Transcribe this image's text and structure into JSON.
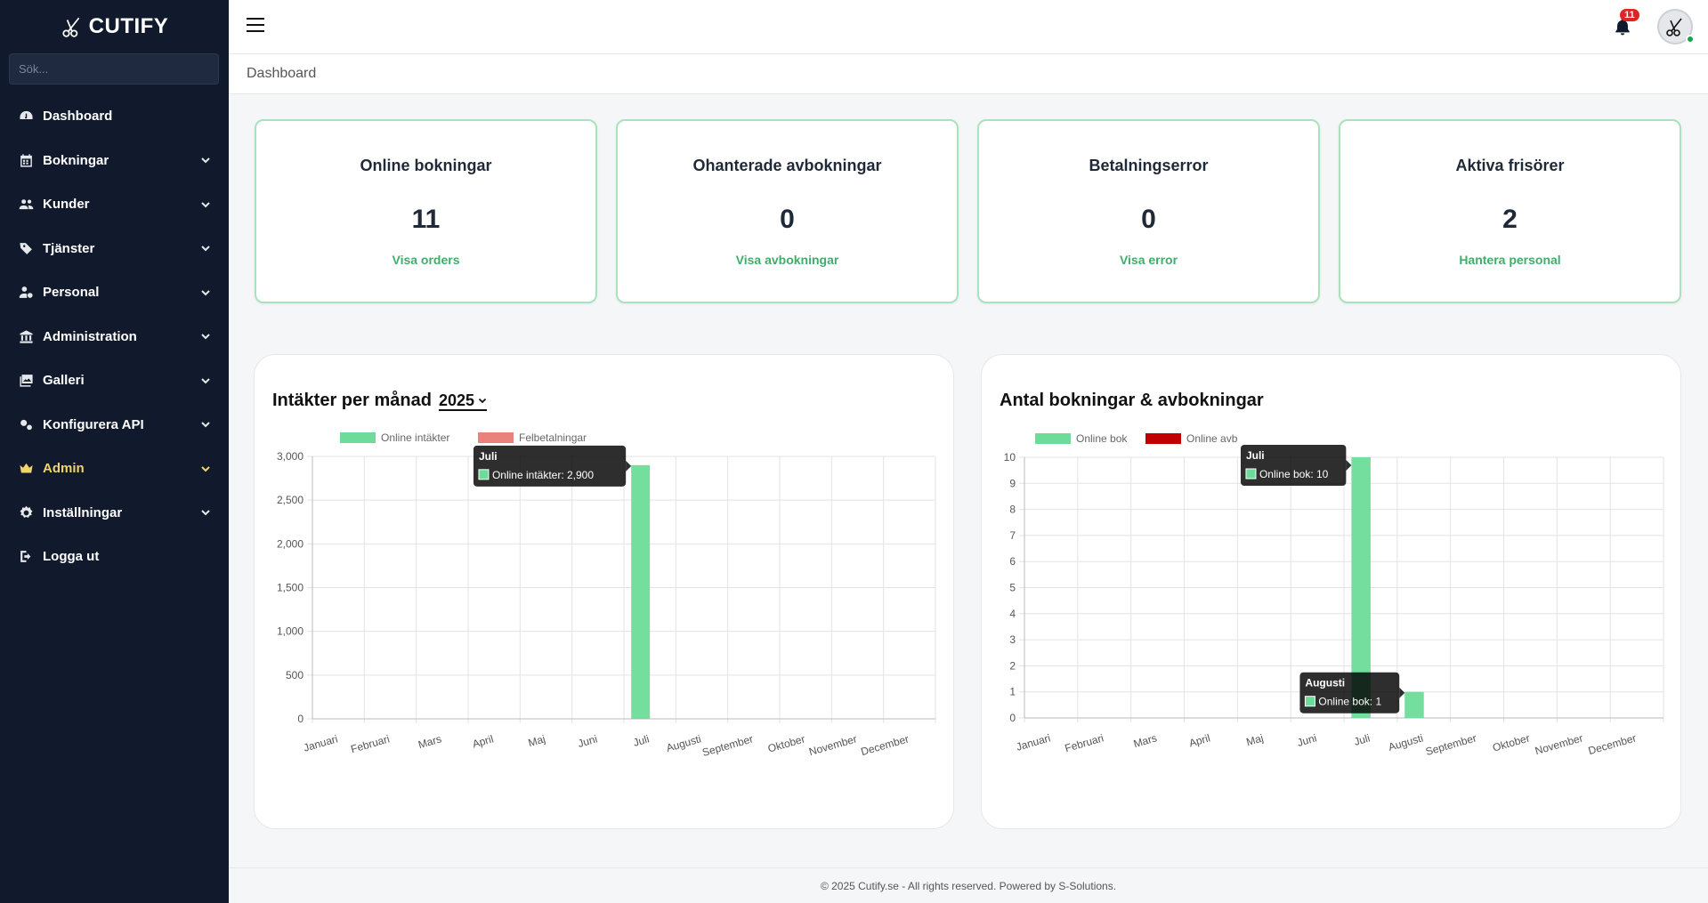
{
  "app": {
    "name": "CUTIFY"
  },
  "sidebar": {
    "search_placeholder": "Sök...",
    "items": [
      {
        "label": "Dashboard",
        "icon": "gauge-icon",
        "chevron": false
      },
      {
        "label": "Bokningar",
        "icon": "calendar-icon",
        "chevron": true
      },
      {
        "label": "Kunder",
        "icon": "users-icon",
        "chevron": true
      },
      {
        "label": "Tjänster",
        "icon": "tags-icon",
        "chevron": true
      },
      {
        "label": "Personal",
        "icon": "user-gear-icon",
        "chevron": true
      },
      {
        "label": "Administration",
        "icon": "bank-icon",
        "chevron": true
      },
      {
        "label": "Galleri",
        "icon": "images-icon",
        "chevron": true
      },
      {
        "label": "Konfigurera API",
        "icon": "gears-icon",
        "chevron": true
      },
      {
        "label": "Admin",
        "icon": "crown-icon",
        "chevron": true
      },
      {
        "label": "Inställningar",
        "icon": "gear-icon",
        "chevron": true
      },
      {
        "label": "Logga ut",
        "icon": "logout-icon",
        "chevron": false
      }
    ]
  },
  "topbar": {
    "notification_count": "11"
  },
  "breadcrumb": "Dashboard",
  "cards": [
    {
      "title": "Online bokningar",
      "value": "11",
      "link": "Visa orders"
    },
    {
      "title": "Ohanterade avbokningar",
      "value": "0",
      "link": "Visa avbokningar"
    },
    {
      "title": "Betalningserror",
      "value": "0",
      "link": "Visa error"
    },
    {
      "title": "Aktiva frisörer",
      "value": "2",
      "link": "Hantera personal"
    }
  ],
  "colors": {
    "accent": "#3fae6a",
    "sidebar": "#111a2d",
    "series_green": "#6ddc9a",
    "series_red": "#e9827a",
    "series_darkred": "#c00000"
  },
  "charts": {
    "revenue": {
      "title": "Intäkter per månad",
      "year": "2025"
    },
    "bookings": {
      "title": "Antal bokningar & avbokningar"
    }
  },
  "chart_data": [
    {
      "type": "bar",
      "title": "Intäkter per månad",
      "categories": [
        "Januari",
        "Februari",
        "Mars",
        "April",
        "Maj",
        "Juni",
        "Juli",
        "Augusti",
        "September",
        "Oktober",
        "November",
        "December"
      ],
      "series": [
        {
          "name": "Online intäkter",
          "color": "#6ddc9a",
          "values": [
            0,
            0,
            0,
            0,
            0,
            0,
            2900,
            0,
            0,
            0,
            0,
            0
          ]
        },
        {
          "name": "Felbetalningar",
          "color": "#e9827a",
          "values": [
            0,
            0,
            0,
            0,
            0,
            0,
            0,
            0,
            0,
            0,
            0,
            0
          ]
        }
      ],
      "ylim": [
        0,
        3000
      ],
      "yticks": [
        "0",
        "500",
        "1,000",
        "1,500",
        "2,000",
        "2,500",
        "3,000"
      ],
      "tooltips": [
        {
          "title": "Juli",
          "text": "Online intäkter: 2,900",
          "category": 6
        }
      ]
    },
    {
      "type": "bar",
      "title": "Antal bokningar & avbokningar",
      "categories": [
        "Januari",
        "Februari",
        "Mars",
        "April",
        "Maj",
        "Juni",
        "Juli",
        "Augusti",
        "September",
        "Oktober",
        "November",
        "December"
      ],
      "series": [
        {
          "name": "Online bok",
          "color": "#6ddc9a",
          "values": [
            0,
            0,
            0,
            0,
            0,
            0,
            10,
            1,
            0,
            0,
            0,
            0
          ]
        },
        {
          "name": "Online avb",
          "color": "#c00000",
          "values": [
            0,
            0,
            0,
            0,
            0,
            0,
            0,
            0,
            0,
            0,
            0,
            0
          ]
        }
      ],
      "ylim": [
        0,
        10
      ],
      "yticks": [
        "0",
        "1",
        "2",
        "3",
        "4",
        "5",
        "6",
        "7",
        "8",
        "9",
        "10"
      ],
      "tooltips": [
        {
          "title": "Juli",
          "text": "Online bok: 10",
          "category": 6
        },
        {
          "title": "Augusti",
          "text": "Online bok: 1",
          "category": 7
        }
      ]
    }
  ],
  "footer": "© 2025 Cutify.se - All rights reserved. Powered by S-Solutions."
}
